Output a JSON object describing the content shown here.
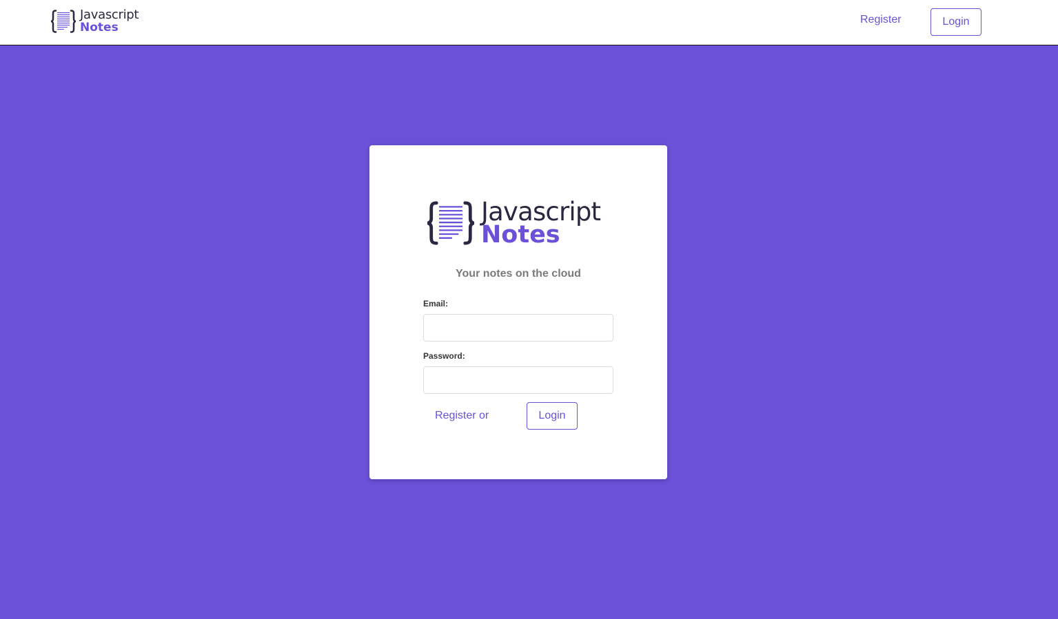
{
  "colors": {
    "brand": "#6a51d8",
    "logo_dark": "#2a2840",
    "background": "#6a51d8",
    "card": "#ffffff",
    "subtitle": "#7a7a7a"
  },
  "navbar": {
    "logo": {
      "icon": "notes-braces-icon",
      "line1": "Javascript",
      "line2": "Notes"
    },
    "register_label": "Register",
    "login_label": "Login"
  },
  "login_card": {
    "logo": {
      "icon": "notes-braces-icon",
      "line1": "Javascript",
      "line2": "Notes"
    },
    "subtitle": "Your notes on the cloud",
    "email": {
      "label": "Email:",
      "value": "",
      "placeholder": ""
    },
    "password": {
      "label": "Password:",
      "value": "",
      "placeholder": ""
    },
    "register_label": "Register or",
    "login_label": "Login"
  }
}
